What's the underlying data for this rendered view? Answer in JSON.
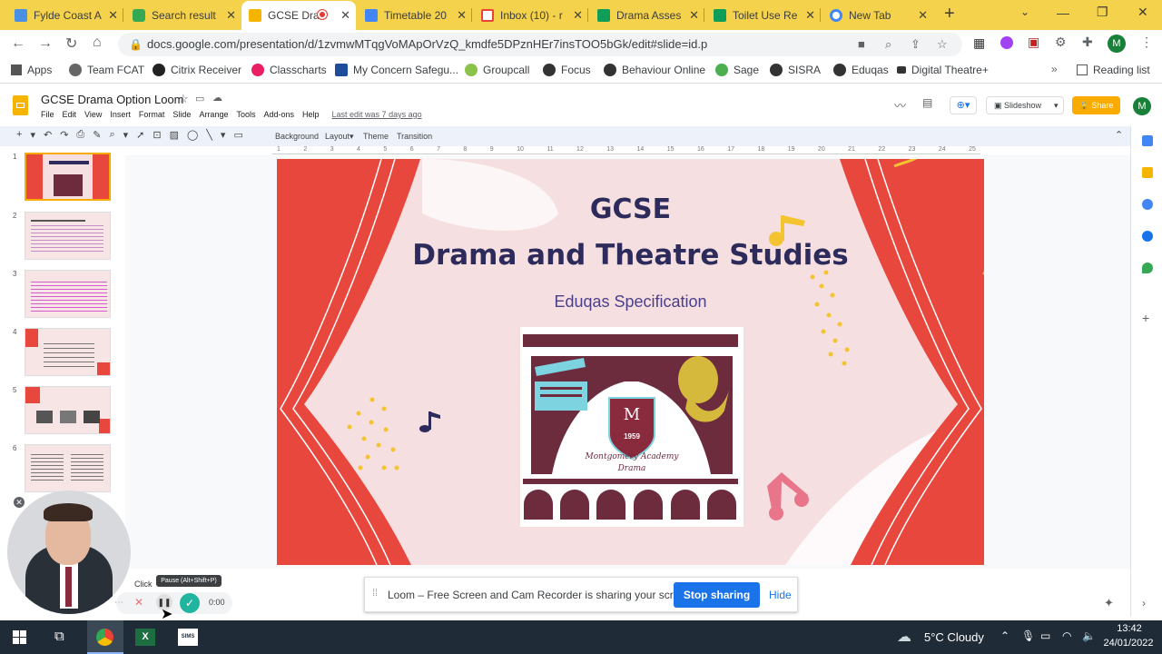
{
  "tabs": [
    {
      "label": "Fylde Coast A",
      "color": "#4a90e2"
    },
    {
      "label": "Search result",
      "color": "#34a853"
    },
    {
      "label": "GCSE Dra",
      "color": "#f4b400"
    },
    {
      "label": "Timetable 20",
      "color": "#4285f4"
    },
    {
      "label": "Inbox (10) - r",
      "color": "#ea4335"
    },
    {
      "label": "Drama Asses",
      "color": "#0f9d58"
    },
    {
      "label": "Toilet Use Re",
      "color": "#0f9d58"
    },
    {
      "label": "New Tab",
      "color": "#4285f4"
    }
  ],
  "url": "docs.google.com/presentation/d/1zvmwMTqgVoMApOrVzQ_kmdfe5DPznHEr7insTOO5bGk/edit#slide=id.p",
  "bookmarks": [
    "Apps",
    "Team FCAT",
    "Citrix Receiver",
    "Classcharts",
    "My Concern Safegu...",
    "Groupcall",
    "Focus",
    "Behaviour Online",
    "Sage",
    "SISRA",
    "Eduqas",
    "Digital Theatre+"
  ],
  "reading_list": "Reading list",
  "profile_initial": "M",
  "doc": {
    "title": "GCSE Drama Option Loom",
    "menus": [
      "File",
      "Edit",
      "View",
      "Insert",
      "Format",
      "Slide",
      "Arrange",
      "Tools",
      "Add-ons",
      "Help"
    ],
    "last_edit": "Last edit was 7 days ago",
    "slideshow": "Slideshow",
    "share": "Share"
  },
  "toolbar": {
    "background": "Background",
    "layout": "Layout",
    "theme": "Theme",
    "transition": "Transition"
  },
  "ruler_ticks": [
    "1",
    "2",
    "3",
    "4",
    "5",
    "6",
    "7",
    "8",
    "9",
    "10",
    "11",
    "12",
    "13",
    "14",
    "15",
    "16",
    "17",
    "18",
    "19",
    "20",
    "21",
    "22",
    "23",
    "24",
    "25"
  ],
  "thumbnails": [
    "1",
    "2",
    "3",
    "4",
    "5",
    "6"
  ],
  "slide": {
    "line1": "GCSE",
    "line2": "Drama and Theatre Studies",
    "subtitle": "Eduqas Specification",
    "logo_year": "1959",
    "logo_text1": "Montgomery Academy",
    "logo_text2": "Drama"
  },
  "loom": {
    "message": "Loom – Free Screen and Cam Recorder is sharing your screen.",
    "stop": "Stop sharing",
    "hide": "Hide",
    "tooltip": "Pause (Alt+Shift+P)",
    "timer": "0:00",
    "click_hint": "Click"
  },
  "taskbar": {
    "weather": "5°C  Cloudy",
    "time": "13:42",
    "date": "24/01/2022",
    "sims": "SIMS"
  }
}
